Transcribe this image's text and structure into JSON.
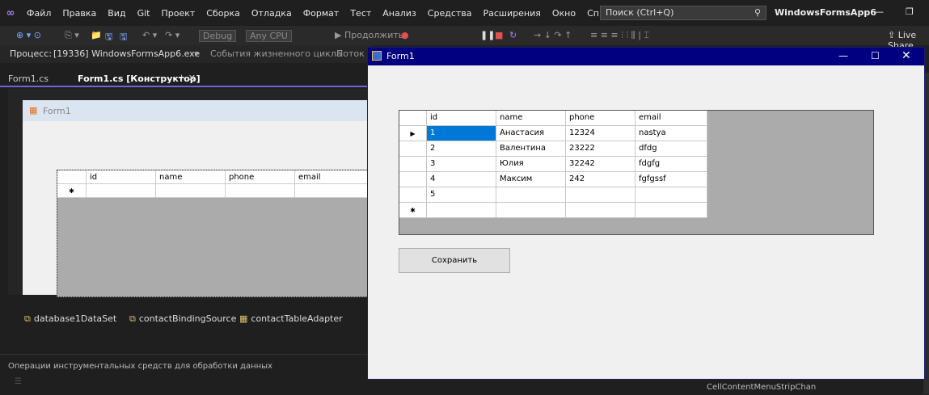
{
  "menu": {
    "items": [
      "Файл",
      "Правка",
      "Вид",
      "Git",
      "Проект",
      "Сборка",
      "Отладка",
      "Формат",
      "Тест",
      "Анализ",
      "Средства",
      "Расширения",
      "Окно",
      "Справка"
    ],
    "search_placeholder": "Поиск (Ctrl+Q)",
    "project_name": "WindowsFormsApp6"
  },
  "toolbar": {
    "config": "Debug",
    "platform": "Any CPU",
    "continue_label": "▶ Продолжить",
    "live_share": "Live Share"
  },
  "process_bar": {
    "label": "Процесс:",
    "value": "[19336] WindowsFormsApp6.exe",
    "lifecycle": "События жизненного цикла",
    "thread": "Поток"
  },
  "tabs": [
    {
      "label": "Form1.cs"
    },
    {
      "label": "Form1.cs [Конструктор]"
    }
  ],
  "designer": {
    "form_title": "Form1",
    "columns": [
      "id",
      "name",
      "phone",
      "email"
    ]
  },
  "tray": {
    "components": [
      "database1DataSet",
      "contactBindingSource",
      "contactTableAdapter"
    ]
  },
  "bottom_panel": {
    "text": "Операции инструментальных средств для обработки данных"
  },
  "events": {
    "visible": "CellContentMenuStripChan"
  },
  "runform": {
    "title": "Form1",
    "columns": [
      "id",
      "name",
      "phone",
      "email"
    ],
    "rows": [
      {
        "id": "1",
        "name": "Анастасия",
        "phone": "12324",
        "email": "nastya"
      },
      {
        "id": "2",
        "name": "Валентина",
        "phone": "23222",
        "email": "dfdg"
      },
      {
        "id": "3",
        "name": "Юлия",
        "phone": "32242",
        "email": "fdgfg"
      },
      {
        "id": "4",
        "name": "Максим",
        "phone": "242",
        "email": "fgfgssf"
      },
      {
        "id": "5",
        "name": "",
        "phone": "",
        "email": ""
      }
    ],
    "save_label": "Сохранить"
  },
  "colors": {
    "titlebar": "#000080",
    "selection": "#0078d7",
    "accent": "#7160e8"
  }
}
